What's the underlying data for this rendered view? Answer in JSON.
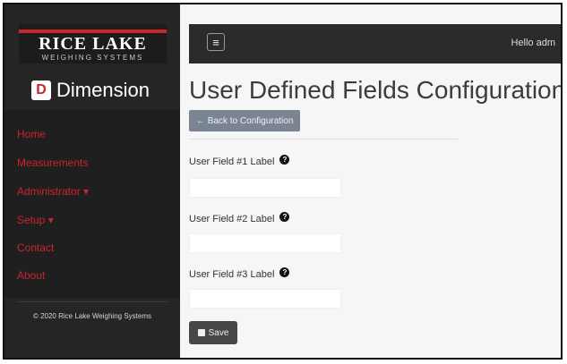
{
  "sidebar": {
    "logo": {
      "brand": "RICE LAKE",
      "tagline": "WEIGHING SYSTEMS"
    },
    "product": {
      "icon_letter": "D",
      "name": "Dimension",
      "mark": "•"
    },
    "nav": [
      {
        "label": "Home"
      },
      {
        "label": "Measurements"
      },
      {
        "label": "Administrator ▾"
      },
      {
        "label": "Setup ▾"
      },
      {
        "label": "Contact"
      },
      {
        "label": "About"
      }
    ],
    "copyright": "© 2020 Rice Lake Weighing Systems"
  },
  "topbar": {
    "menu_icon": "hamburger-icon",
    "menu_glyph": "≡",
    "greeting": "Hello adm"
  },
  "main": {
    "title": "User Defined Fields Configuration",
    "back_button": "← Back to Configuration",
    "fields": [
      {
        "label": "User Field #1 Label",
        "value": ""
      },
      {
        "label": "User Field #2 Label",
        "value": ""
      },
      {
        "label": "User Field #3 Label",
        "value": ""
      }
    ],
    "help_glyph": "?",
    "save_button": "Save"
  },
  "colors": {
    "accent_red": "#c8252c",
    "sidebar_bg": "#252525",
    "topbar_bg": "#2b2b2b",
    "back_button_bg": "#7a8591",
    "save_button_bg": "#474747"
  }
}
